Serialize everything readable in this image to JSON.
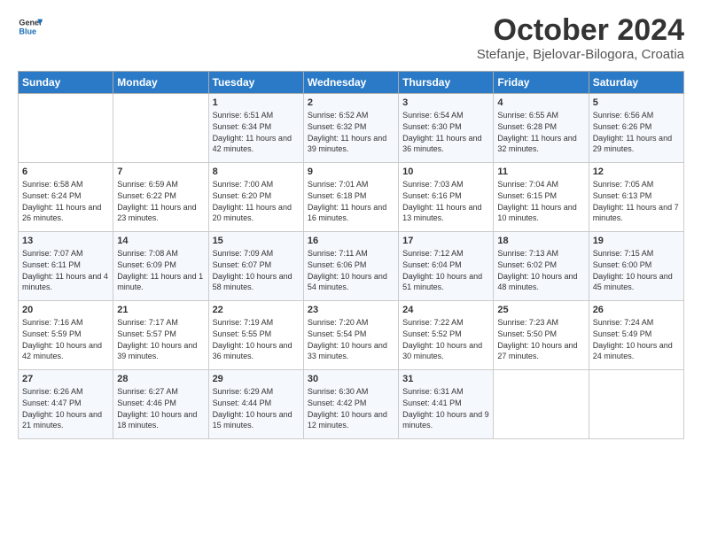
{
  "header": {
    "logo_line1": "General",
    "logo_line2": "Blue",
    "month_title": "October 2024",
    "location": "Stefanje, Bjelovar-Bilogora, Croatia"
  },
  "days_of_week": [
    "Sunday",
    "Monday",
    "Tuesday",
    "Wednesday",
    "Thursday",
    "Friday",
    "Saturday"
  ],
  "weeks": [
    [
      {
        "day": "",
        "info": ""
      },
      {
        "day": "",
        "info": ""
      },
      {
        "day": "1",
        "info": "Sunrise: 6:51 AM\nSunset: 6:34 PM\nDaylight: 11 hours and 42 minutes."
      },
      {
        "day": "2",
        "info": "Sunrise: 6:52 AM\nSunset: 6:32 PM\nDaylight: 11 hours and 39 minutes."
      },
      {
        "day": "3",
        "info": "Sunrise: 6:54 AM\nSunset: 6:30 PM\nDaylight: 11 hours and 36 minutes."
      },
      {
        "day": "4",
        "info": "Sunrise: 6:55 AM\nSunset: 6:28 PM\nDaylight: 11 hours and 32 minutes."
      },
      {
        "day": "5",
        "info": "Sunrise: 6:56 AM\nSunset: 6:26 PM\nDaylight: 11 hours and 29 minutes."
      }
    ],
    [
      {
        "day": "6",
        "info": "Sunrise: 6:58 AM\nSunset: 6:24 PM\nDaylight: 11 hours and 26 minutes."
      },
      {
        "day": "7",
        "info": "Sunrise: 6:59 AM\nSunset: 6:22 PM\nDaylight: 11 hours and 23 minutes."
      },
      {
        "day": "8",
        "info": "Sunrise: 7:00 AM\nSunset: 6:20 PM\nDaylight: 11 hours and 20 minutes."
      },
      {
        "day": "9",
        "info": "Sunrise: 7:01 AM\nSunset: 6:18 PM\nDaylight: 11 hours and 16 minutes."
      },
      {
        "day": "10",
        "info": "Sunrise: 7:03 AM\nSunset: 6:16 PM\nDaylight: 11 hours and 13 minutes."
      },
      {
        "day": "11",
        "info": "Sunrise: 7:04 AM\nSunset: 6:15 PM\nDaylight: 11 hours and 10 minutes."
      },
      {
        "day": "12",
        "info": "Sunrise: 7:05 AM\nSunset: 6:13 PM\nDaylight: 11 hours and 7 minutes."
      }
    ],
    [
      {
        "day": "13",
        "info": "Sunrise: 7:07 AM\nSunset: 6:11 PM\nDaylight: 11 hours and 4 minutes."
      },
      {
        "day": "14",
        "info": "Sunrise: 7:08 AM\nSunset: 6:09 PM\nDaylight: 11 hours and 1 minute."
      },
      {
        "day": "15",
        "info": "Sunrise: 7:09 AM\nSunset: 6:07 PM\nDaylight: 10 hours and 58 minutes."
      },
      {
        "day": "16",
        "info": "Sunrise: 7:11 AM\nSunset: 6:06 PM\nDaylight: 10 hours and 54 minutes."
      },
      {
        "day": "17",
        "info": "Sunrise: 7:12 AM\nSunset: 6:04 PM\nDaylight: 10 hours and 51 minutes."
      },
      {
        "day": "18",
        "info": "Sunrise: 7:13 AM\nSunset: 6:02 PM\nDaylight: 10 hours and 48 minutes."
      },
      {
        "day": "19",
        "info": "Sunrise: 7:15 AM\nSunset: 6:00 PM\nDaylight: 10 hours and 45 minutes."
      }
    ],
    [
      {
        "day": "20",
        "info": "Sunrise: 7:16 AM\nSunset: 5:59 PM\nDaylight: 10 hours and 42 minutes."
      },
      {
        "day": "21",
        "info": "Sunrise: 7:17 AM\nSunset: 5:57 PM\nDaylight: 10 hours and 39 minutes."
      },
      {
        "day": "22",
        "info": "Sunrise: 7:19 AM\nSunset: 5:55 PM\nDaylight: 10 hours and 36 minutes."
      },
      {
        "day": "23",
        "info": "Sunrise: 7:20 AM\nSunset: 5:54 PM\nDaylight: 10 hours and 33 minutes."
      },
      {
        "day": "24",
        "info": "Sunrise: 7:22 AM\nSunset: 5:52 PM\nDaylight: 10 hours and 30 minutes."
      },
      {
        "day": "25",
        "info": "Sunrise: 7:23 AM\nSunset: 5:50 PM\nDaylight: 10 hours and 27 minutes."
      },
      {
        "day": "26",
        "info": "Sunrise: 7:24 AM\nSunset: 5:49 PM\nDaylight: 10 hours and 24 minutes."
      }
    ],
    [
      {
        "day": "27",
        "info": "Sunrise: 6:26 AM\nSunset: 4:47 PM\nDaylight: 10 hours and 21 minutes."
      },
      {
        "day": "28",
        "info": "Sunrise: 6:27 AM\nSunset: 4:46 PM\nDaylight: 10 hours and 18 minutes."
      },
      {
        "day": "29",
        "info": "Sunrise: 6:29 AM\nSunset: 4:44 PM\nDaylight: 10 hours and 15 minutes."
      },
      {
        "day": "30",
        "info": "Sunrise: 6:30 AM\nSunset: 4:42 PM\nDaylight: 10 hours and 12 minutes."
      },
      {
        "day": "31",
        "info": "Sunrise: 6:31 AM\nSunset: 4:41 PM\nDaylight: 10 hours and 9 minutes."
      },
      {
        "day": "",
        "info": ""
      },
      {
        "day": "",
        "info": ""
      }
    ]
  ]
}
